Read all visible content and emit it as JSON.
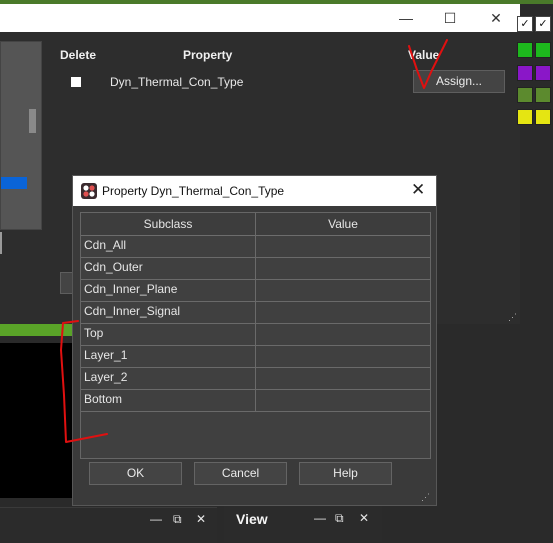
{
  "background_window": {
    "controls": {
      "minimize": "—",
      "maximize": "☐",
      "close": "✕"
    },
    "columns": {
      "delete": "Delete",
      "property": "Property",
      "value": "Value"
    },
    "row": {
      "property": "Dyn_Thermal_Con_Type",
      "assign_label": "Assign..."
    }
  },
  "dialog": {
    "title": "Property Dyn_Thermal_Con_Type",
    "close": "✕",
    "columns": {
      "subclass": "Subclass",
      "value": "Value"
    },
    "rows": [
      {
        "subclass": "Cdn_All",
        "value": ""
      },
      {
        "subclass": "Cdn_Outer",
        "value": ""
      },
      {
        "subclass": "Cdn_Inner_Plane",
        "value": ""
      },
      {
        "subclass": "Cdn_Inner_Signal",
        "value": ""
      },
      {
        "subclass": "Top",
        "value": ""
      },
      {
        "subclass": "Layer_1",
        "value": ""
      },
      {
        "subclass": "Layer_2",
        "value": ""
      },
      {
        "subclass": "Bottom",
        "value": ""
      }
    ],
    "buttons": {
      "ok": "OK",
      "cancel": "Cancel",
      "help": "Help"
    }
  },
  "view_panel": {
    "title": "View",
    "controls": {
      "minimize": "—",
      "float": "⧉",
      "close": "✕"
    }
  },
  "left_panel": {
    "controls": {
      "minimize": "—",
      "float": "⧉",
      "close": "✕"
    }
  },
  "swatch_colors": [
    "#1db81d",
    "#8a17c8",
    "#5c8a2e",
    "#e5e512"
  ],
  "annotation_color": "#e01010"
}
